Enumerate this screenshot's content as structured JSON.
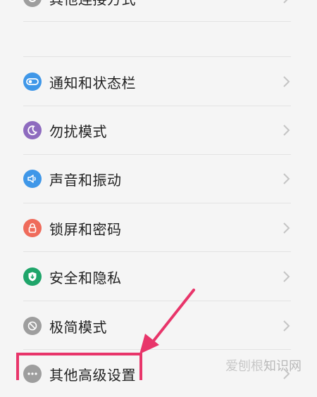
{
  "settings": {
    "items": [
      {
        "label": "其他连接方式",
        "icon": "link-icon",
        "color": "#9e9e9e"
      },
      {
        "label": "通知和状态栏",
        "icon": "notification-toggle-icon",
        "color": "#3f97e8"
      },
      {
        "label": "勿扰模式",
        "icon": "moon-icon",
        "color": "#8e6bbf"
      },
      {
        "label": "声音和振动",
        "icon": "speaker-icon",
        "color": "#3f97e8"
      },
      {
        "label": "锁屏和密码",
        "icon": "lock-icon",
        "color": "#ef6b5b"
      },
      {
        "label": "安全和隐私",
        "icon": "shield-icon",
        "color": "#1fa56a"
      },
      {
        "label": "极简模式",
        "icon": "minimal-mode-icon",
        "color": "#9e9e9e"
      },
      {
        "label": "其他高级设置",
        "icon": "more-icon",
        "color": "#9e9e9e"
      }
    ]
  },
  "watermark": {
    "part1": "爱刨根",
    "part2": "知识网"
  },
  "annotation": {
    "color": "#e8356a"
  }
}
